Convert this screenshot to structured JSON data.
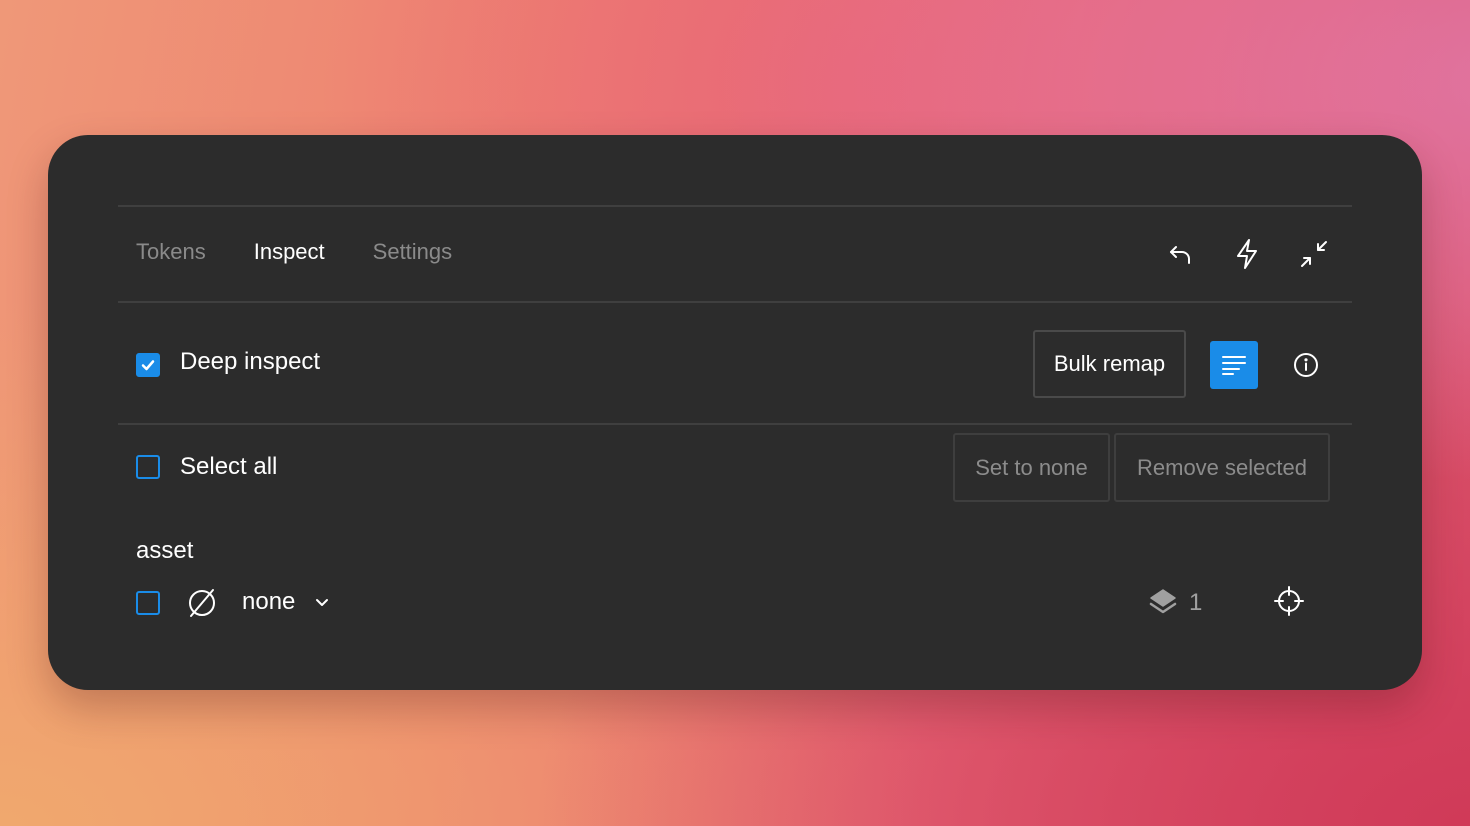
{
  "tabs": [
    {
      "label": "Tokens",
      "active": false
    },
    {
      "label": "Inspect",
      "active": true
    },
    {
      "label": "Settings",
      "active": false
    }
  ],
  "header_icons": [
    "undo-icon",
    "lightning-icon",
    "minimize-icon"
  ],
  "inspect": {
    "deep_inspect_label": "Deep inspect",
    "deep_inspect_checked": true,
    "bulk_remap_label": "Bulk remap",
    "list_view_icon": "list-lines-icon",
    "info_icon": "info-circle-icon"
  },
  "selection": {
    "select_all_label": "Select all",
    "select_all_checked": false,
    "set_to_none_label": "Set to none",
    "remove_selected_label": "Remove selected"
  },
  "group": {
    "title": "asset",
    "items": [
      {
        "checked": false,
        "token_icon": "empty-set-icon",
        "value": "none",
        "layer_count": "1"
      }
    ]
  },
  "colors": {
    "accent": "#1a8ce8",
    "panel_bg": "#2c2c2c",
    "divider": "#3f3f3f",
    "muted_text": "#8a8a8a"
  }
}
